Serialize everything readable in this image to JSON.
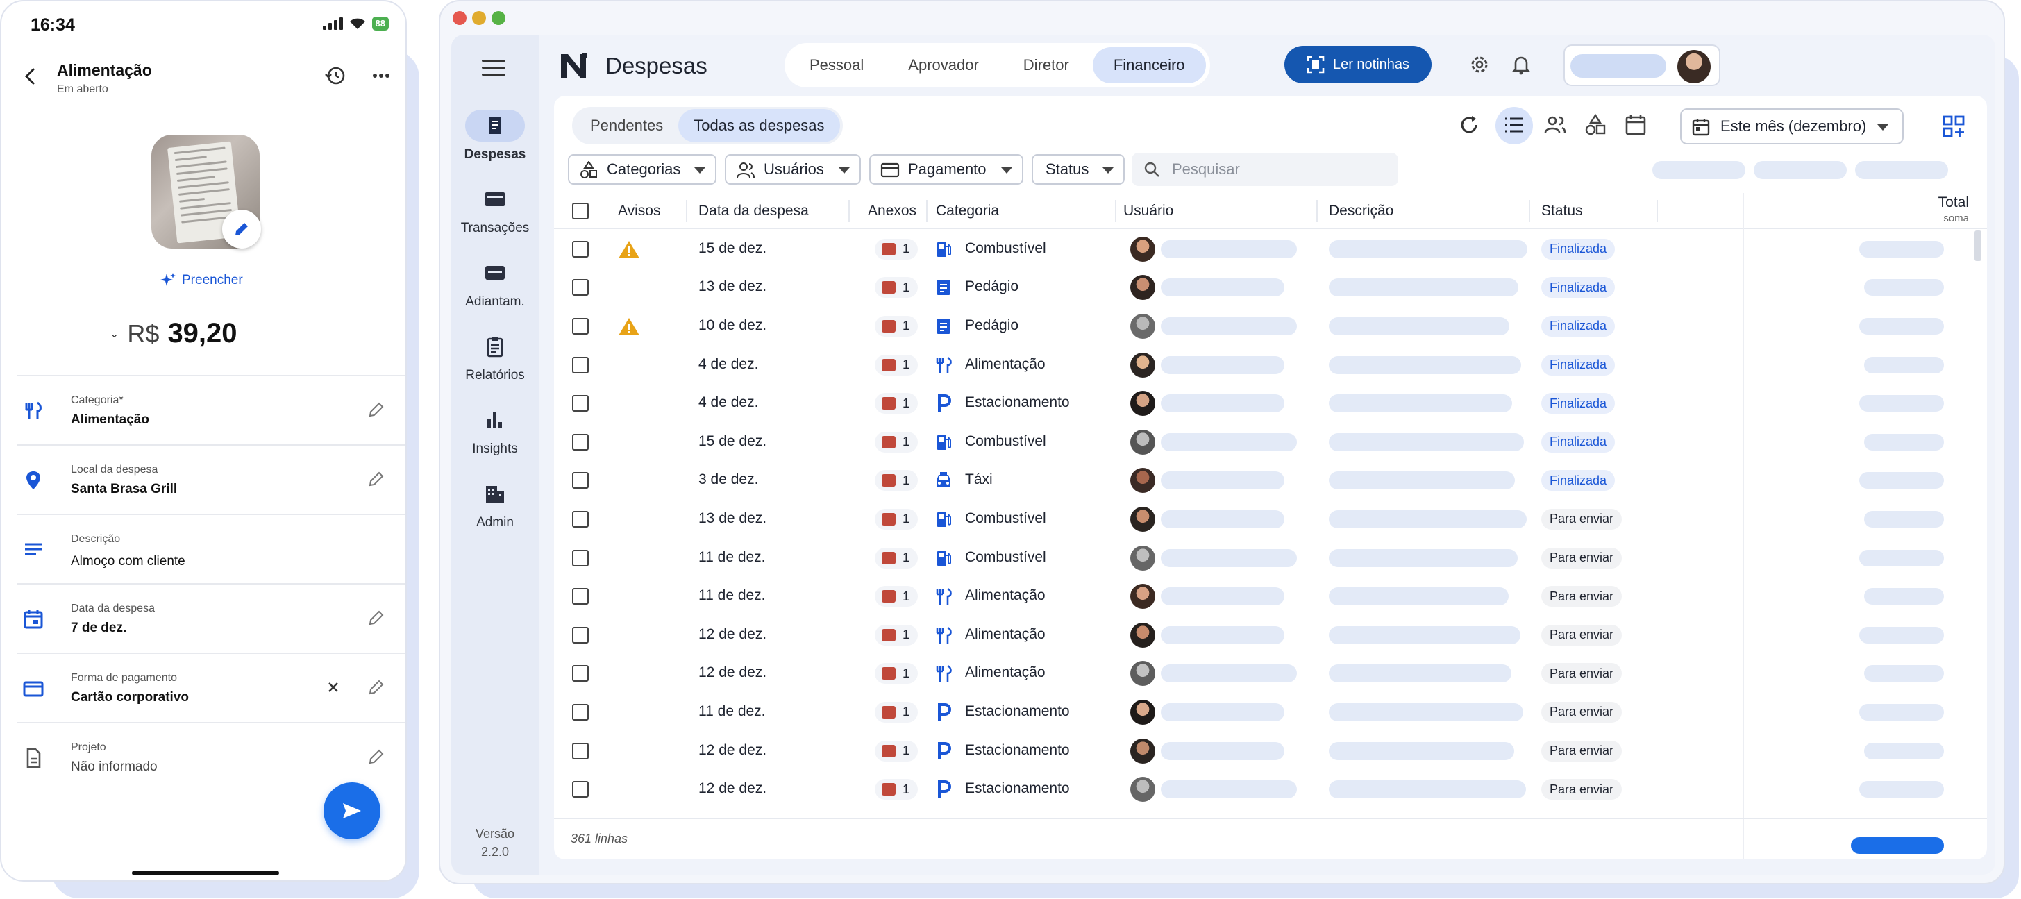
{
  "phone": {
    "time": "16:34",
    "battery": "88",
    "title": "Alimentação",
    "subtitle": "Em aberto",
    "fill_label": "Preencher",
    "currency": "R$",
    "amount": "39,20",
    "fields": [
      {
        "label": "Categoria*",
        "value": "Alimentação",
        "icon": "fork-knife-icon"
      },
      {
        "label": "Local da despesa",
        "value": "Santa Brasa Grill",
        "icon": "location-pin-icon"
      },
      {
        "label": "Descrição",
        "value": "Almoço com cliente",
        "icon": "notes-icon"
      },
      {
        "label": "Data da despesa",
        "value": "7 de dez.",
        "icon": "calendar-icon"
      },
      {
        "label": "Forma de pagamento",
        "value": "Cartão corporativo",
        "icon": "credit-card-icon"
      },
      {
        "label": "Projeto",
        "value": "Não informado",
        "icon": "document-icon"
      }
    ]
  },
  "desktop": {
    "app_title": "Despesas",
    "nav": [
      {
        "label": "Despesas",
        "icon": "receipt-icon",
        "active": true
      },
      {
        "label": "Transações",
        "icon": "credit-card-icon"
      },
      {
        "label": "Adiantam.",
        "icon": "wallet-icon"
      },
      {
        "label": "Relatórios",
        "icon": "clipboard-icon"
      },
      {
        "label": "Insights",
        "icon": "bar-chart-icon"
      },
      {
        "label": "Admin",
        "icon": "building-icon"
      }
    ],
    "version_label": "Versão",
    "version": "2.2.0",
    "roles": [
      "Pessoal",
      "Aprovador",
      "Diretor",
      "Financeiro"
    ],
    "active_role": "Financeiro",
    "read_button": "Ler notinhas",
    "tabs": [
      "Pendentes",
      "Todas as despesas"
    ],
    "active_tab": "Todas as despesas",
    "period": "Este mês (dezembro)",
    "filters": [
      "Categorias",
      "Usuários",
      "Pagamento",
      "Status"
    ],
    "search_placeholder": "Pesquisar",
    "columns": {
      "avisos": "Avisos",
      "data": "Data da despesa",
      "anexos": "Anexos",
      "categoria": "Categoria",
      "usuario": "Usuário",
      "descricao": "Descrição",
      "status": "Status",
      "total": "Total",
      "total_sub": "soma"
    },
    "rows": [
      {
        "warn": true,
        "date": "15 de dez.",
        "att": "1",
        "category": "Combustível",
        "cat_icon": "fuel-icon",
        "status": "Finalizada"
      },
      {
        "warn": false,
        "date": "13 de dez.",
        "att": "1",
        "category": "Pedágio",
        "cat_icon": "toll-icon",
        "status": "Finalizada"
      },
      {
        "warn": true,
        "date": "10 de dez.",
        "att": "1",
        "category": "Pedágio",
        "cat_icon": "toll-icon",
        "status": "Finalizada"
      },
      {
        "warn": false,
        "date": "4 de dez.",
        "att": "1",
        "category": "Alimentação",
        "cat_icon": "fork-knife-icon",
        "status": "Finalizada"
      },
      {
        "warn": false,
        "date": "4 de dez.",
        "att": "1",
        "category": "Estacionamento",
        "cat_icon": "parking-icon",
        "status": "Finalizada"
      },
      {
        "warn": false,
        "date": "15 de dez.",
        "att": "1",
        "category": "Combustível",
        "cat_icon": "fuel-icon",
        "status": "Finalizada"
      },
      {
        "warn": false,
        "date": "3 de dez.",
        "att": "1",
        "category": "Táxi",
        "cat_icon": "taxi-icon",
        "status": "Finalizada"
      },
      {
        "warn": false,
        "date": "13 de dez.",
        "att": "1",
        "category": "Combustível",
        "cat_icon": "fuel-icon",
        "status": "Para enviar"
      },
      {
        "warn": false,
        "date": "11 de dez.",
        "att": "1",
        "category": "Combustível",
        "cat_icon": "fuel-icon",
        "status": "Para enviar"
      },
      {
        "warn": false,
        "date": "11 de dez.",
        "att": "1",
        "category": "Alimentação",
        "cat_icon": "fork-knife-icon",
        "status": "Para enviar"
      },
      {
        "warn": false,
        "date": "12 de dez.",
        "att": "1",
        "category": "Alimentação",
        "cat_icon": "fork-knife-icon",
        "status": "Para enviar"
      },
      {
        "warn": false,
        "date": "12 de dez.",
        "att": "1",
        "category": "Alimentação",
        "cat_icon": "fork-knife-icon",
        "status": "Para enviar"
      },
      {
        "warn": false,
        "date": "11 de dez.",
        "att": "1",
        "category": "Estacionamento",
        "cat_icon": "parking-icon",
        "status": "Para enviar"
      },
      {
        "warn": false,
        "date": "12 de dez.",
        "att": "1",
        "category": "Estacionamento",
        "cat_icon": "parking-icon",
        "status": "Para enviar"
      },
      {
        "warn": false,
        "date": "12 de dez.",
        "att": "1",
        "category": "Estacionamento",
        "cat_icon": "parking-icon",
        "status": "Para enviar"
      }
    ],
    "row_count": "361 linhas"
  },
  "colors": {
    "accent": "#1a6ee8",
    "primary_dark": "#1557b0",
    "active_pill": "#d8e3fa",
    "warning": "#e8a317",
    "attachment": "#c0483a"
  }
}
